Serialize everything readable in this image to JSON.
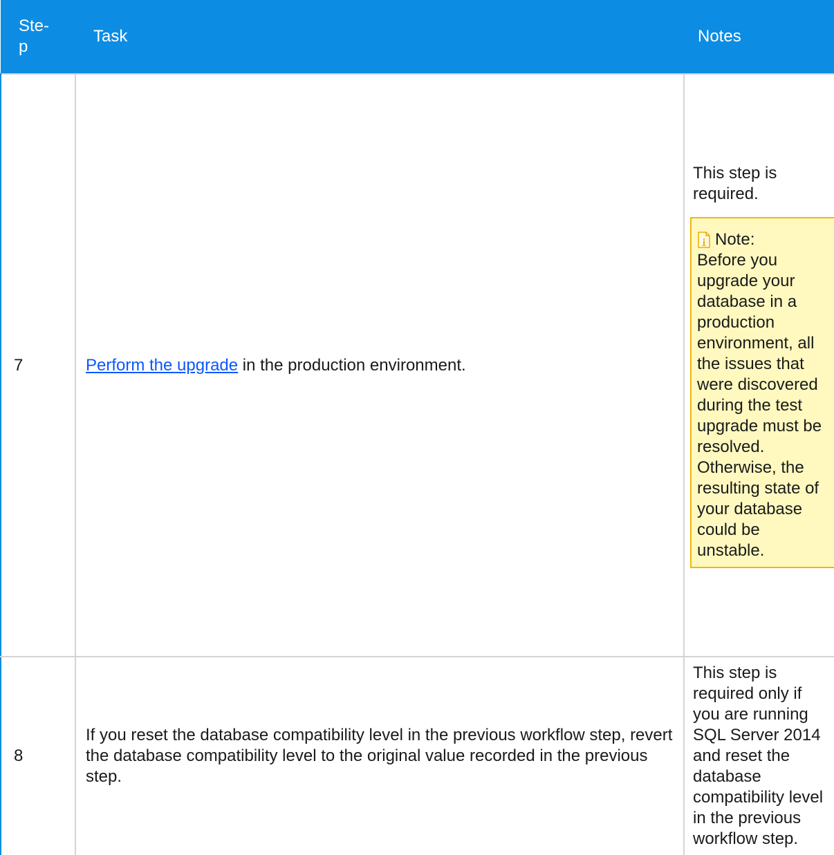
{
  "table": {
    "headers": {
      "step": "Ste-p",
      "task": "Task",
      "notes": "Notes"
    },
    "rows": [
      {
        "step": "7",
        "task_link": "Perform the upgrade",
        "task_rest": " in the production environment.",
        "notes_text": "This step is required.",
        "note": {
          "icon": "info-note-icon",
          "label": "Note:",
          "text": "Before you upgrade your database in a production environment, all the issues that were discovered during the test upgrade must be resolved. Otherwise, the resulting state of your database could be unstable."
        }
      },
      {
        "step": "8",
        "task": "If you reset the database compatibility level in the previous workflow step, revert the database compatibility level to the original value recorded in the previous step.",
        "notes_text": "This step is required only if you are running SQL Server 2014 and reset the database compatibility level in the previous workflow step."
      }
    ]
  },
  "colors": {
    "header_bg": "#0c8de3",
    "link": "#0b57ff",
    "note_bg": "#fff9bf",
    "note_border": "#f2b705"
  }
}
